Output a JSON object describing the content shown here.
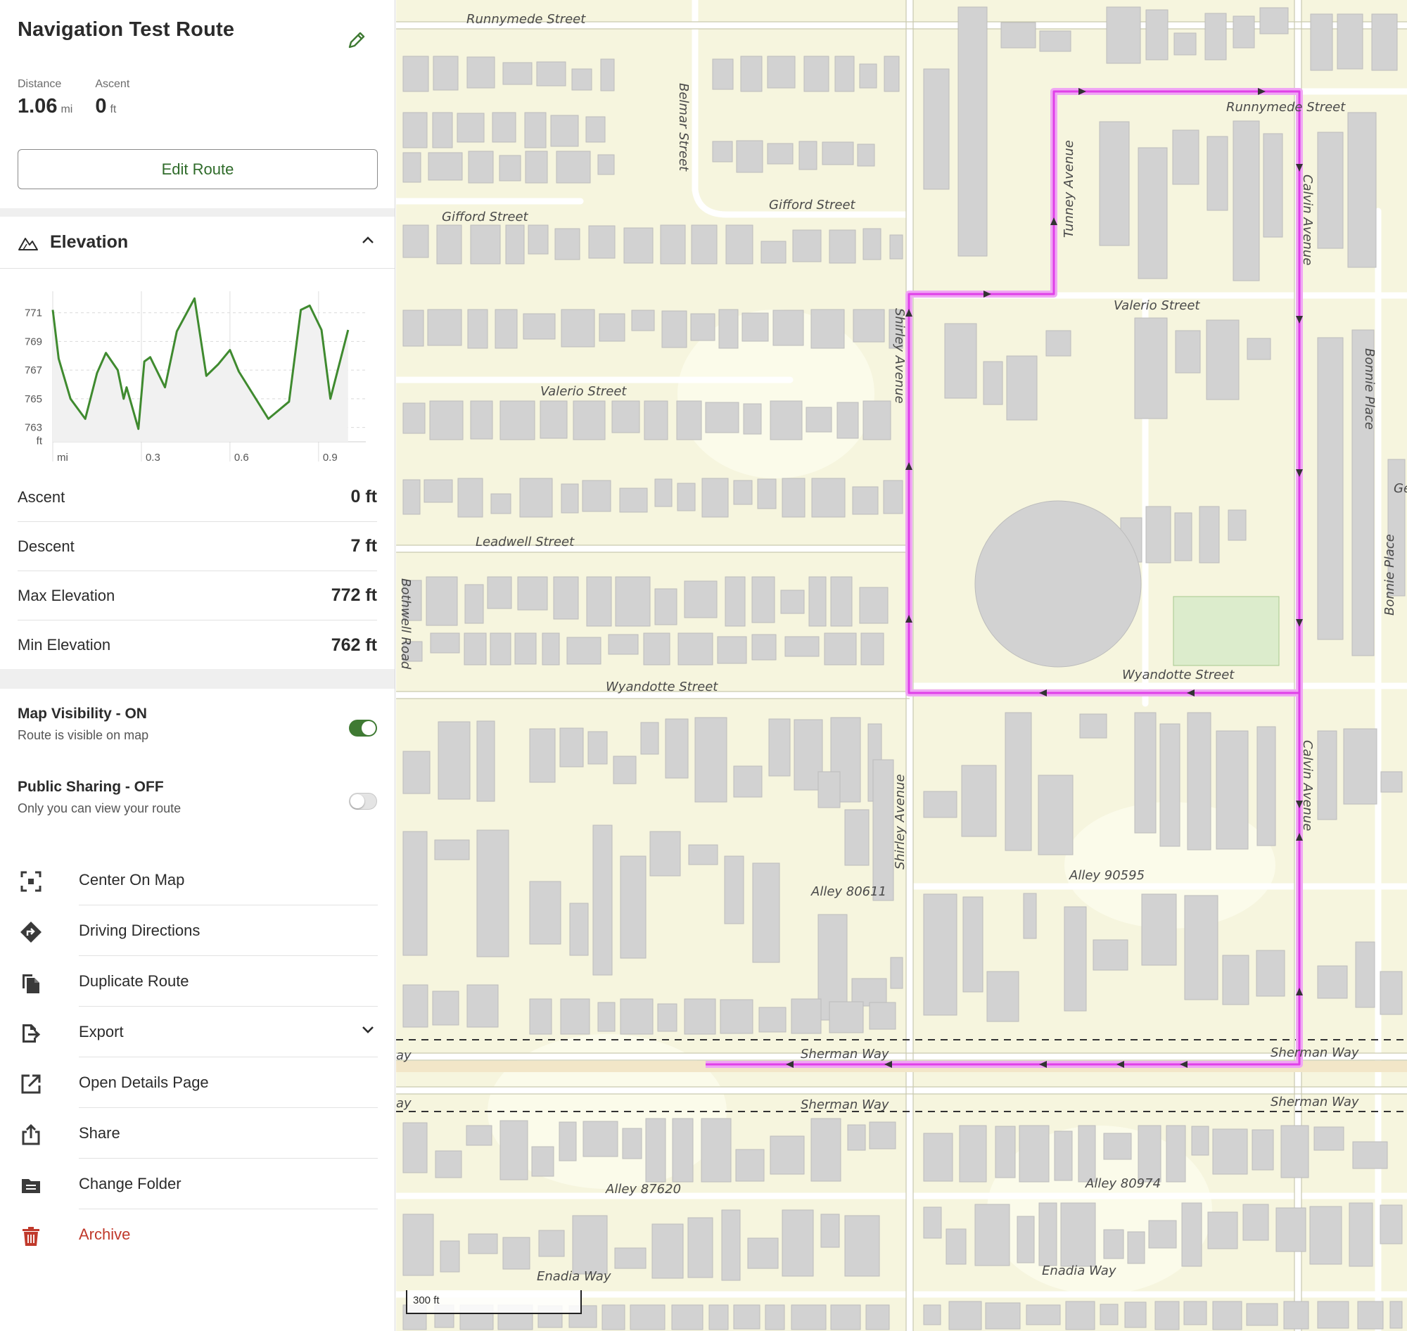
{
  "route": {
    "title": "Navigation Test Route",
    "distance_label": "Distance",
    "distance_value": "1.06",
    "distance_unit": "mi",
    "ascent_label": "Ascent",
    "ascent_value": "0",
    "ascent_unit": "ft",
    "edit_button": "Edit Route"
  },
  "elevation": {
    "title": "Elevation",
    "y_ticks": [
      "771",
      "769",
      "767",
      "765",
      "763"
    ],
    "y_unit": "ft",
    "x_ticks": [
      "mi",
      "0.3",
      "0.6",
      "0.9"
    ],
    "line_color": "#3f8a2f",
    "chart_data": {
      "type": "line",
      "x": [
        0.0,
        0.02,
        0.06,
        0.11,
        0.15,
        0.18,
        0.22,
        0.24,
        0.25,
        0.29,
        0.31,
        0.33,
        0.38,
        0.42,
        0.48,
        0.52,
        0.56,
        0.6,
        0.63,
        0.73,
        0.8,
        0.84,
        0.87,
        0.91,
        0.94,
        1.0
      ],
      "y": [
        771.2,
        767.8,
        765.0,
        763.6,
        766.8,
        768.2,
        767.0,
        765.0,
        765.8,
        762.9,
        767.6,
        767.9,
        765.8,
        769.7,
        772.0,
        766.6,
        767.4,
        768.4,
        766.9,
        763.6,
        764.8,
        771.2,
        771.5,
        769.8,
        765.0,
        769.8
      ],
      "xlim": [
        0,
        1.06
      ],
      "ylim": [
        762,
        772.5
      ],
      "grid": true
    }
  },
  "stats": [
    {
      "label": "Ascent",
      "value": "0 ft"
    },
    {
      "label": "Descent",
      "value": "7 ft"
    },
    {
      "label": "Max Elevation",
      "value": "772 ft"
    },
    {
      "label": "Min Elevation",
      "value": "762 ft"
    }
  ],
  "visibility": {
    "title": "Map Visibility - ON",
    "subtitle": "Route is visible on map",
    "on": true
  },
  "sharing": {
    "title": "Public Sharing - OFF",
    "subtitle": "Only you can view your route",
    "on": false
  },
  "actions": [
    {
      "label": "Center On Map",
      "icon": "center-icon"
    },
    {
      "label": "Driving Directions",
      "icon": "directions-icon"
    },
    {
      "label": "Duplicate Route",
      "icon": "duplicate-icon"
    },
    {
      "label": "Export",
      "icon": "export-icon"
    },
    {
      "label": "Open Details Page",
      "icon": "open-external-icon"
    },
    {
      "label": "Share",
      "icon": "share-icon"
    },
    {
      "label": "Change Folder",
      "icon": "folder-icon"
    },
    {
      "label": "Archive",
      "icon": "trash-icon"
    }
  ],
  "colors": {
    "accent": "#3f7a33",
    "route": "#e040e8",
    "danger": "#c0392b",
    "map_bg": "#f6f5de",
    "building": "#d2d2d2"
  },
  "map": {
    "scale_label": "300 ft",
    "streets": {
      "runnymede_w": "Runnymede Street",
      "runnymede_e": "Runnymede Street",
      "belmar": "Belmar Street",
      "gifford_w": "Gifford Street",
      "gifford_e": "Gifford Street",
      "tunney": "Tunney Avenue",
      "calvin_n": "Calvin Avenue",
      "valerio_w": "Valerio Street",
      "valerio_e": "Valerio Street",
      "shirley_n": "Shirley Avenue",
      "bonnie_1": "Bonnie Place",
      "bonnie_2": "Bonnie Place",
      "ge": "Ge",
      "leadwell": "Leadwell Street",
      "bothwell": "Bothwell Road",
      "wyandotte_w": "Wyandotte Street",
      "wyandotte_e": "Wyandotte Street",
      "shirley_s": "Shirley Avenue",
      "calvin_s": "Calvin Avenue",
      "alley_90595": "Alley 90595",
      "alley_80611": "Alley 80611",
      "way_1": "ay",
      "way_2": "ay",
      "sherman_1": "Sherman Way",
      "sherman_2": "Sherman Way",
      "sherman_3": "Sherman Way",
      "sherman_4": "Sherman Way",
      "alley_87620": "Alley 87620",
      "alley_80974": "Alley 80974",
      "enadia_w": "Enadia Way",
      "enadia_e": "Enadia Way"
    }
  }
}
